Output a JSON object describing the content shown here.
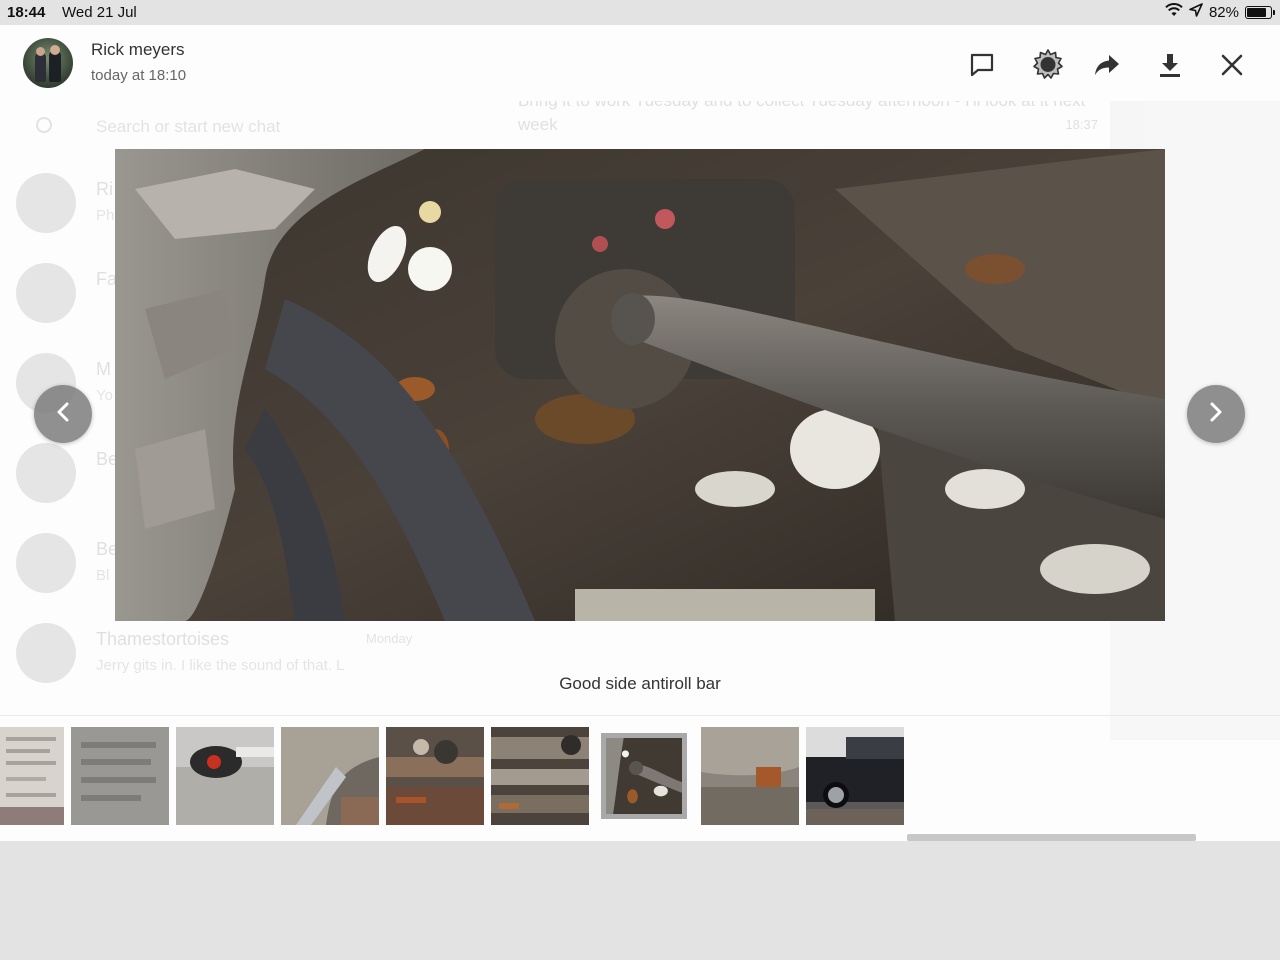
{
  "status_bar": {
    "time": "18:44",
    "date": "Wed 21 Jul",
    "battery_text": "82%",
    "battery_level": 0.82,
    "icons": [
      "wifi-icon",
      "location-icon",
      "battery-icon"
    ]
  },
  "header": {
    "sender_name": "Rick meyers",
    "timestamp": "today at 18:10",
    "actions": [
      "comment-icon",
      "sticker-icon",
      "forward-icon",
      "download-icon",
      "close-icon"
    ]
  },
  "photo": {
    "caption": "Good side antiroll bar"
  },
  "navigation": {
    "previous": "chevron-left-icon",
    "next": "chevron-right-icon"
  },
  "thumbnails": {
    "count_visible": 9,
    "selected_index": 6
  },
  "background_chat": {
    "search_placeholder": "Search or start new chat",
    "bubble_text": "Bring it to work Tuesday and to collect Tuesday afternoon - I'll look at it next week",
    "bubble_time": "18:37",
    "rows": [
      {
        "name": "Ri",
        "msg": "Ph"
      },
      {
        "name": "Fa",
        "msg": ""
      },
      {
        "name": "M",
        "msg": "Yo"
      },
      {
        "name": "Be",
        "msg": ""
      },
      {
        "name": "Be",
        "msg": "Bl"
      },
      {
        "name": "Thamestortoises",
        "msg": "Jerry gits in. I like the sound of that. L",
        "time": "Monday"
      }
    ]
  },
  "colors": {
    "overlay_bg": "#fdfdfd",
    "nav_button": "#787878",
    "status_bar_bg": "#e3e3e3",
    "selected_thumb_border": "#a9a9a9"
  }
}
